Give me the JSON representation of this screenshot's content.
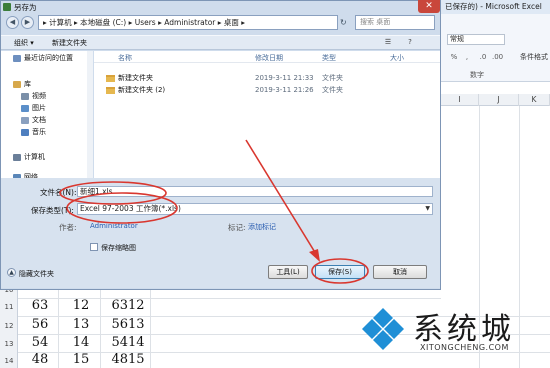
{
  "excel": {
    "title": "已保存的) - Microsoft Excel",
    "font_combo": "常规",
    "group_label": "数字",
    "cond_format": "条件格式",
    "columns": [
      "I",
      "J",
      "K"
    ],
    "rows": [
      {
        "num": "10",
        "a": "",
        "b": "",
        "c": ""
      },
      {
        "num": "11",
        "a": "63",
        "b": "12",
        "c": "6312"
      },
      {
        "num": "12",
        "a": "56",
        "b": "13",
        "c": "5613"
      },
      {
        "num": "13",
        "a": "54",
        "b": "14",
        "c": "5414"
      },
      {
        "num": "14",
        "a": "48",
        "b": "15",
        "c": "4815"
      }
    ]
  },
  "dialog": {
    "title": "另存为",
    "close": "✕",
    "address": "▸ 计算机 ▸ 本地磁盘 (C:) ▸ Users ▸ Administrator ▸ 桌面 ▸",
    "search_placeholder": "搜索 桌面",
    "toolbar": {
      "organize": "组织 ▾",
      "new_folder": "新建文件夹"
    },
    "nav": [
      {
        "label": "最近访问的位置",
        "color": "#6d8fbf"
      },
      {
        "label": "",
        "color": "#fff"
      },
      {
        "label": "库",
        "color": "#d7a84b"
      },
      {
        "label": "视频",
        "color": "#7b8fa8"
      },
      {
        "label": "图片",
        "color": "#5b8fc9"
      },
      {
        "label": "文档",
        "color": "#8aa0bf"
      },
      {
        "label": "音乐",
        "color": "#4e7fbf"
      },
      {
        "label": "",
        "color": "#fff"
      },
      {
        "label": "计算机",
        "color": "#6b7f99"
      },
      {
        "label": "",
        "color": "#fff"
      },
      {
        "label": "网络",
        "color": "#5a86b8"
      }
    ],
    "columns": {
      "name": "名称",
      "date": "修改日期",
      "type": "类型",
      "size": "大小"
    },
    "files": [
      {
        "name": "新建文件夹",
        "date": "2019-3-11 21:33",
        "type": "文件夹"
      },
      {
        "name": "新建文件夹 (2)",
        "date": "2019-3-11 21:26",
        "type": "文件夹"
      }
    ],
    "filename_label": "文件名(N):",
    "filename_value": "新细1.xls",
    "filetype_label": "保存类型(T):",
    "filetype_value": "Excel 97-2003 工作簿(*.xls)",
    "author_label": "作者:",
    "author_value": "Administrator",
    "tags_label": "标记:",
    "tags_value": "添加标记",
    "thumb_label": "保存缩略图",
    "hide_folders": "隐藏文件夹",
    "tools": "工具(L)",
    "save": "保存(S)",
    "cancel": "取消"
  },
  "watermark": {
    "title": "系统城",
    "sub": "XITONGCHENG.COM"
  },
  "colors": {
    "annotation": "#d9372f",
    "logo_blue": "#1f8fd6"
  }
}
